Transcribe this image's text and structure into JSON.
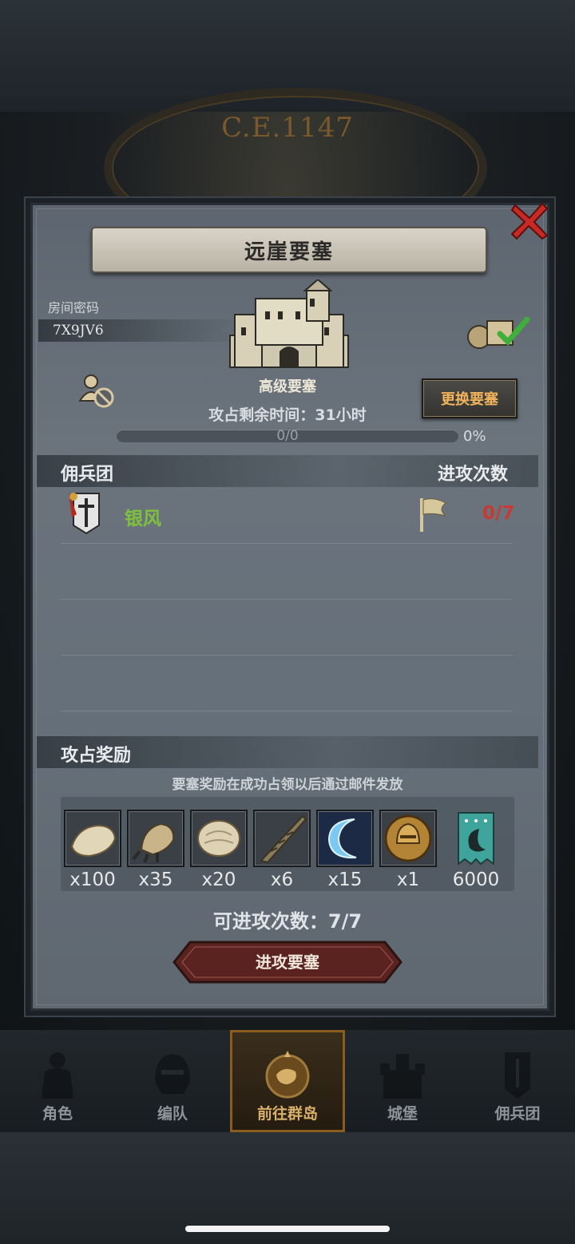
{
  "game": {
    "era_label": "C.E.1147"
  },
  "dialog": {
    "title": "远崖要塞",
    "room_code_label": "房间密码",
    "room_code": "7X9JV6",
    "fort_level": "高级要塞",
    "change_button": "更换要塞",
    "time_label_prefix": "攻占剩余时间：",
    "time_value": "31",
    "time_unit": "小时",
    "progress_text": "0/0",
    "progress_percent": "0%",
    "progress_fraction": 0,
    "mercenary_header": "佣兵团",
    "attack_count_header": "进攻次数",
    "mercenaries": [
      {
        "name": "银风",
        "attack_count": "0/7"
      }
    ],
    "reward_header": "攻占奖励",
    "reward_note": "要塞奖励在成功占领以后通过邮件发放",
    "rewards": [
      {
        "icon": "fur-pelt-icon",
        "qty": "x100"
      },
      {
        "icon": "beast-claw-icon",
        "qty": "x35"
      },
      {
        "icon": "hide-icon",
        "qty": "x20"
      },
      {
        "icon": "horn-icon",
        "qty": "x6"
      },
      {
        "icon": "crescent-rune-icon",
        "qty": "x15"
      },
      {
        "icon": "knight-helmet-medal-icon",
        "qty": "x1"
      },
      {
        "icon": "guild-banner-icon",
        "qty": "6000"
      }
    ],
    "attempts_label": "可进攻次数：7/7",
    "attack_button": "进攻要塞"
  },
  "bottom_nav": [
    {
      "label": "角色",
      "icon": "knight-icon",
      "active": false
    },
    {
      "label": "编队",
      "icon": "helmet-formation-icon",
      "active": false
    },
    {
      "label": "前往群岛",
      "icon": "compass-map-icon",
      "active": true
    },
    {
      "label": "城堡",
      "icon": "castle-icon",
      "active": false
    },
    {
      "label": "佣兵团",
      "icon": "mercenary-icon",
      "active": false
    }
  ],
  "colors": {
    "accent_gold": "#f1b45c",
    "mercenary_green": "#7fc03d",
    "attack_red": "#c63a33",
    "close_red": "#c72a24"
  }
}
